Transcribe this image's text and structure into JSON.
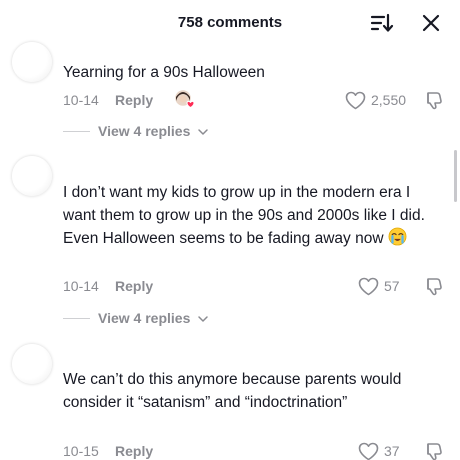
{
  "header": {
    "title": "758 comments",
    "sort_icon": "sort-icon",
    "close_icon": "close-icon"
  },
  "comments": [
    {
      "text": "Yearning for a 90s Halloween",
      "date": "10-14",
      "reply_label": "Reply",
      "likes": "2,550",
      "view_replies": "View 4 replies",
      "has_replier_avatars": true
    },
    {
      "text": "I don’t want my kids to grow up in the modern era I want them to grow up in the 90s and 2000s like I did. Even Halloween seems to be fading away now",
      "emoji": "loudly-crying-face",
      "date": "10-14",
      "reply_label": "Reply",
      "likes": "57",
      "view_replies": "View 4 replies"
    },
    {
      "text": "We can’t do this anymore because parents would consider it “satanism” and “indoctrination”",
      "date": "10-15",
      "reply_label": "Reply",
      "likes": "37"
    }
  ],
  "colors": {
    "text": "#161823",
    "secondary": "#8a8b91",
    "accent": "#fe2c55"
  }
}
